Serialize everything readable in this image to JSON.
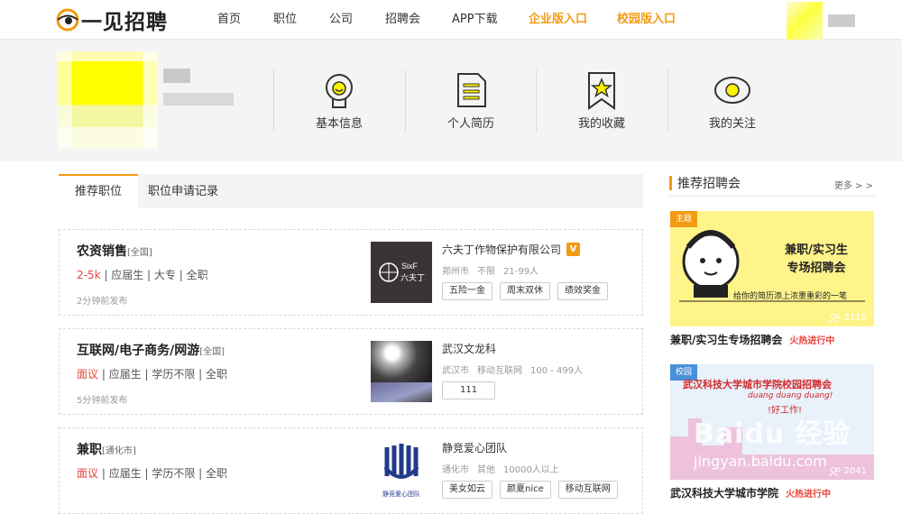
{
  "header": {
    "logo_text": "一见招聘",
    "nav": [
      {
        "label": "首页"
      },
      {
        "label": "职位"
      },
      {
        "label": "公司"
      },
      {
        "label": "招聘会"
      },
      {
        "label": "APP下载"
      },
      {
        "label": "企业版入口"
      },
      {
        "label": "校园版入口"
      }
    ]
  },
  "profile": {
    "quick_links": [
      {
        "label": "基本信息",
        "icon": "bulb-avatar-icon"
      },
      {
        "label": "个人简历",
        "icon": "document-icon"
      },
      {
        "label": "我的收藏",
        "icon": "bookmark-star-icon"
      },
      {
        "label": "我的关注",
        "icon": "eye-icon"
      }
    ]
  },
  "tabs": [
    {
      "label": "推荐职位",
      "active": true
    },
    {
      "label": "职位申请记录",
      "active": false
    }
  ],
  "jobs": [
    {
      "title": "农资销售",
      "location": "[全国]",
      "salary": "2-5k",
      "meta_rest": " | 应届生 | 大专 | 全职",
      "time": "2分钟前发布",
      "company": "六夫丁作物保护有限公司",
      "verified": "V",
      "city": "郑州市",
      "industry": "不限",
      "size": "21-99人",
      "tags": [
        "五险一金",
        "周末双休",
        "绩效奖金"
      ],
      "logo_text": "SixF 六夫丁"
    },
    {
      "title": "互联网/电子商务/网游",
      "location": "[全国]",
      "salary": "面议",
      "meta_rest": " | 应届生 | 学历不限 | 全职",
      "time": "5分钟前发布",
      "company": "武汉文龙科",
      "city": "武汉市",
      "industry": "移动互联网",
      "size": "100 - 499人",
      "tags": [
        "111"
      ]
    },
    {
      "title": "兼职",
      "location": "[通化市]",
      "salary": "面议",
      "meta_rest": " | 应届生 | 学历不限 | 全职",
      "company": "静竞爱心团队",
      "city": "通化市",
      "industry": "其他",
      "size": "10000人以上",
      "tags": [
        "美女如云",
        "颜夏nice",
        "移动互联网"
      ],
      "logo_text": "静竞爱心团队"
    }
  ],
  "sidebar": {
    "title": "推荐招聘会",
    "more": "更多 > >",
    "fairs": [
      {
        "badge": "主题",
        "count": "2115",
        "poster_line1": "兼职/实习生",
        "poster_line2": "专场招聘会",
        "poster_sub": "给你的简历添上浓墨重彩的一笔",
        "title": "兼职/实习生专场招聘会",
        "status": "火热进行中"
      },
      {
        "badge": "校园",
        "count": "2041",
        "poster_line1": "武汉科技大学城市学院校园招聘会",
        "poster_sub": "duang duang duang!",
        "poster_sub2": "!好工作!",
        "watermark": "Baidu 经验",
        "watermark_url": "jingyan.baidu.com",
        "title": "武汉科技大学城市学院",
        "status": "火热进行中"
      }
    ]
  },
  "colors": {
    "accent": "#f39b12",
    "salary": "#e6453a"
  }
}
